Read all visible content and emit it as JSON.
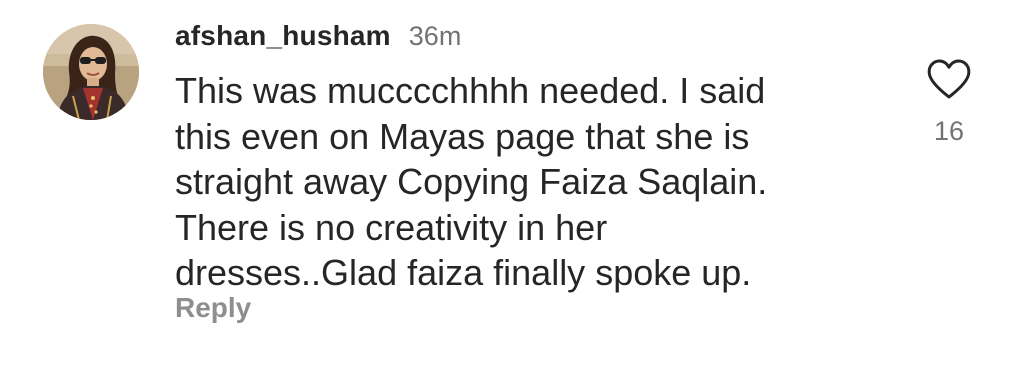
{
  "comment": {
    "username": "afshan_husham",
    "timestamp": "36m",
    "text": "This was mucccchhhh needed. I said\nthis even on Mayas page that she is\nstraight away Copying Faiza Saqlain.\nThere is no creativity in her\ndresses..Glad faiza finally spoke up.",
    "reply_label": "Reply",
    "like_count": "16",
    "like_icon": "heart-outline-icon",
    "avatar": "profile-photo"
  },
  "colors": {
    "text_primary": "#262626",
    "text_secondary": "#737373",
    "reply": "#8e8e8e",
    "background": "#ffffff"
  }
}
